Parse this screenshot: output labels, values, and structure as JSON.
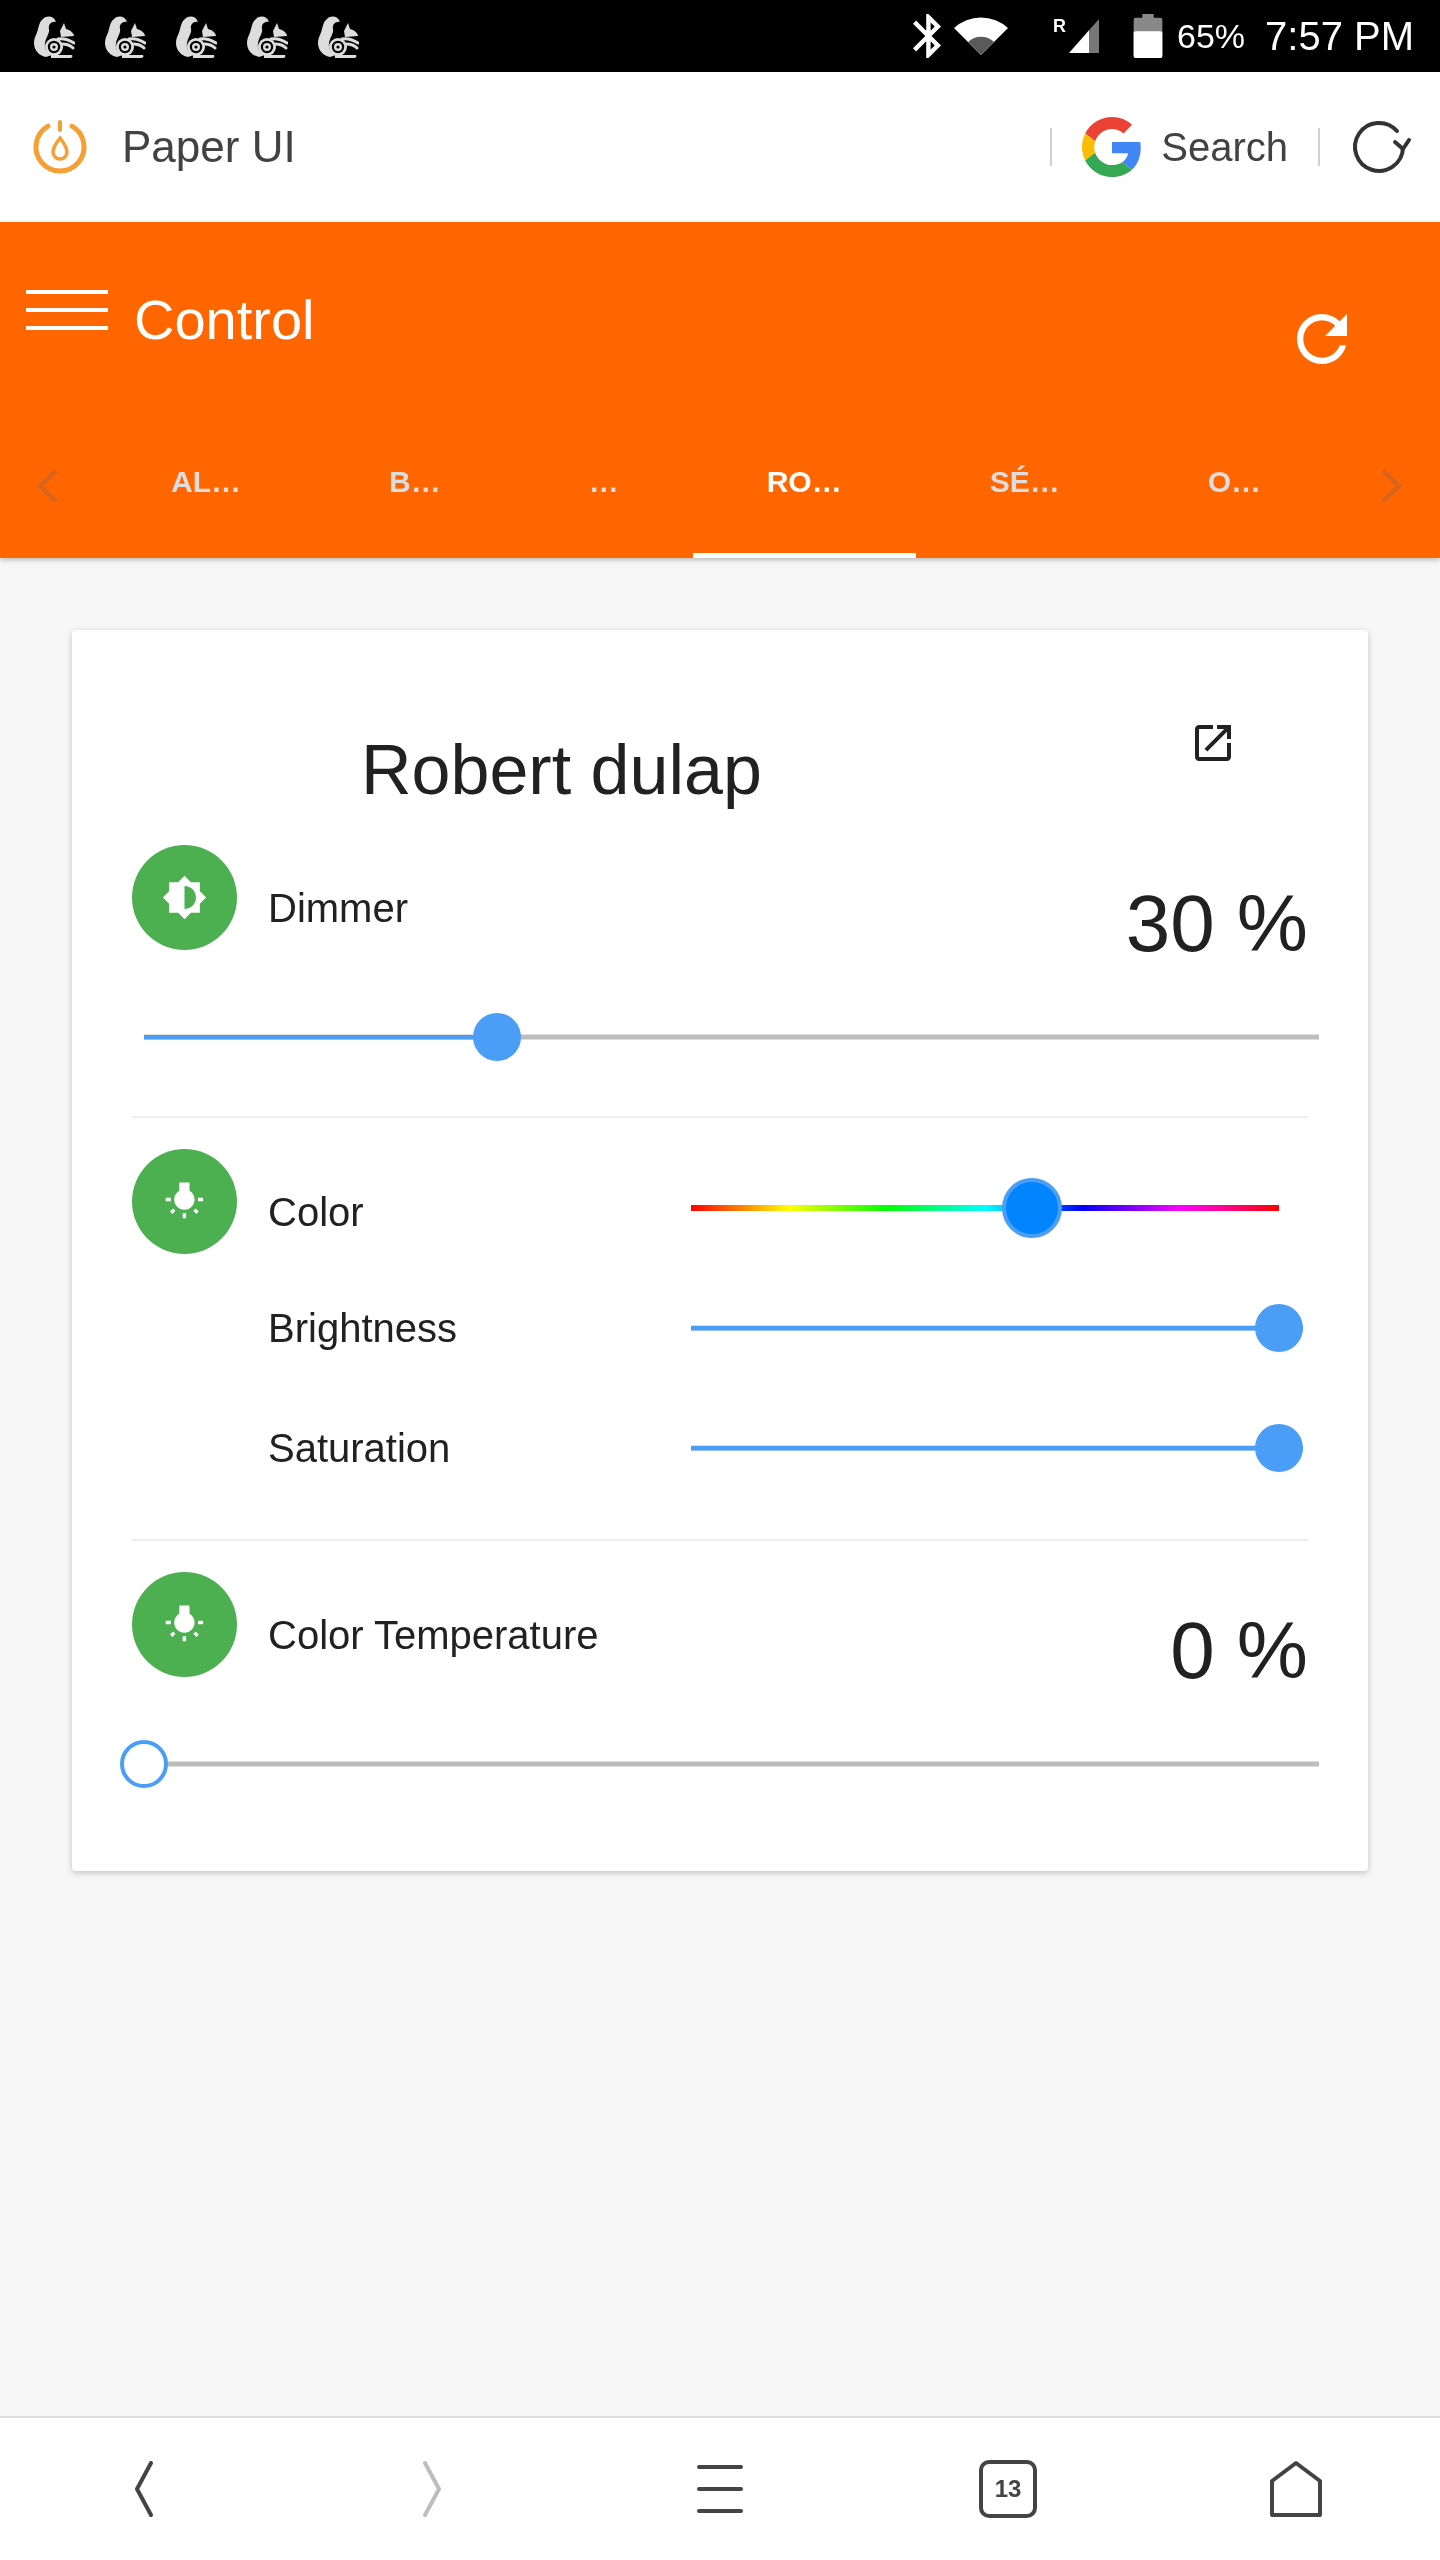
{
  "status_bar": {
    "roaming": "R",
    "battery": "65%",
    "time": "7:57 PM"
  },
  "browser_bar": {
    "title": "Paper UI",
    "search": "Search"
  },
  "app_bar": {
    "title": "Control"
  },
  "tabs": [
    {
      "label": "AL…",
      "selected": false
    },
    {
      "label": "B…",
      "selected": false
    },
    {
      "label": "…",
      "selected": false
    },
    {
      "label": "RO…",
      "selected": true
    },
    {
      "label": "SÉ…",
      "selected": false
    },
    {
      "label": "O…",
      "selected": false
    }
  ],
  "card": {
    "title": "Robert dulap",
    "controls": [
      {
        "kind": "dimmer",
        "label": "Dimmer",
        "reading": "30 %",
        "level": 0.3
      },
      {
        "kind": "color",
        "rows": [
          {
            "kind": "hue",
            "label": "Color",
            "level": 0.58
          },
          {
            "kind": "plain",
            "label": "Brightness",
            "level": 1
          },
          {
            "kind": "plain",
            "label": "Saturation",
            "level": 1
          }
        ]
      },
      {
        "kind": "temperature",
        "label": "Color Temperature",
        "reading": "0 %",
        "level": 0
      }
    ]
  },
  "bottom_nav": {
    "back_disabled": false,
    "forward_disabled": true,
    "tab_count": "13"
  }
}
